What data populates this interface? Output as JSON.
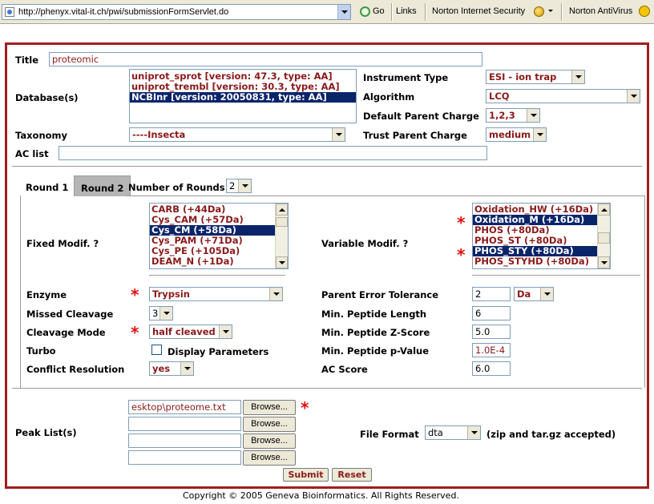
{
  "browser": {
    "url": "http://phenyx.vital-it.ch/pwi/submissionFormServlet.do",
    "go_label": "Go",
    "links_label": "Links",
    "toolbar_items": [
      "Norton Internet Security",
      "Norton AntiVirus"
    ]
  },
  "form": {
    "title_label": "Title",
    "title_value": "proteomic",
    "database_label": "Database(s)",
    "databases": [
      {
        "text": "uniprot_sprot [version: 47.3, type: AA]",
        "selected": false
      },
      {
        "text": "uniprot_trembl [version: 30.3, type: AA]",
        "selected": false
      },
      {
        "text": "NCBInr [version: 20050831, type: AA]",
        "selected": true
      }
    ],
    "instrument_type_label": "Instrument Type",
    "instrument_type_value": "ESI - ion trap",
    "algorithm_label": "Algorithm",
    "algorithm_value": "LCQ",
    "default_parent_charge_label": "Default Parent Charge",
    "default_parent_charge_value": "1,2,3",
    "taxonomy_label": "Taxonomy",
    "taxonomy_value": "----Insecta",
    "trust_parent_charge_label": "Trust Parent Charge",
    "trust_parent_charge_value": "medium",
    "ac_list_label": "AC list",
    "ac_list_value": ""
  },
  "rounds": {
    "tabs": [
      "Round 1",
      "Round 2"
    ],
    "active_tab": "Round 2",
    "number_of_rounds_label": "Number of Rounds",
    "number_of_rounds_value": "2"
  },
  "round": {
    "fixed_modif_label": "Fixed Modif. ?",
    "fixed_modifs": [
      {
        "text": "CARB (+44Da)",
        "selected": false
      },
      {
        "text": "Cys_CAM (+57Da)",
        "selected": false
      },
      {
        "text": "Cys_CM (+58Da)",
        "selected": true
      },
      {
        "text": "Cys_PAM (+71Da)",
        "selected": false
      },
      {
        "text": "Cys_PE (+105Da)",
        "selected": false
      },
      {
        "text": "DEAM_N (+1Da)",
        "selected": false
      }
    ],
    "variable_modif_label": "Variable Modif. ?",
    "variable_modifs": [
      {
        "text": "Oxidation_HW (+16Da)",
        "selected": false
      },
      {
        "text": "Oxidation_M (+16Da)",
        "selected": true
      },
      {
        "text": "PHOS (+80Da)",
        "selected": false
      },
      {
        "text": "PHOS_ST (+80Da)",
        "selected": false
      },
      {
        "text": "PHOS_STY (+80Da)",
        "selected": true
      },
      {
        "text": "PHOS_STYHD (+80Da)",
        "selected": false
      }
    ],
    "enzyme_label": "Enzyme",
    "enzyme_value": "Trypsin",
    "missed_cleavage_label": "Missed Cleavage",
    "missed_cleavage_value": "3",
    "cleavage_mode_label": "Cleavage Mode",
    "cleavage_mode_value": "half cleaved",
    "turbo_label": "Turbo",
    "display_parameters_label": "Display Parameters",
    "conflict_resolution_label": "Conflict Resolution",
    "conflict_resolution_value": "yes",
    "parent_error_tolerance_label": "Parent Error Tolerance",
    "parent_error_tolerance_value": "2",
    "parent_error_unit": "Da",
    "min_peptide_length_label": "Min. Peptide Length",
    "min_peptide_length_value": "6",
    "min_peptide_zscore_label": "Min. Peptide Z-Score",
    "min_peptide_zscore_value": "5.0",
    "min_peptide_pvalue_label": "Min. Peptide p-Value",
    "min_peptide_pvalue_value": "1.0E-4",
    "ac_score_label": "AC Score",
    "ac_score_value": "6.0"
  },
  "peaks": {
    "peak_list_label": "Peak List(s)",
    "files": [
      "esktop\\proteome.txt",
      "",
      "",
      ""
    ],
    "browse_label": "Browse...",
    "file_format_label": "File Format",
    "file_format_value": "dta",
    "file_format_note": "(zip and tar.gz accepted)"
  },
  "actions": {
    "submit_label": "Submit",
    "reset_label": "Reset"
  },
  "footer": {
    "copyright": "Copyright © 2005 Geneva Bioinformatics. All Rights Reserved."
  },
  "colors": {
    "frame_border": "#a11e1e",
    "value_text": "#8b1a1a",
    "selection": "#0a246a",
    "required_star": "#e10f0f"
  },
  "icons": [
    "page-icon",
    "go-icon",
    "globe-icon",
    "norton-icon",
    "dropdown-arrow-icon",
    "scroll-up-icon",
    "scroll-down-icon",
    "required-star-icon"
  ]
}
